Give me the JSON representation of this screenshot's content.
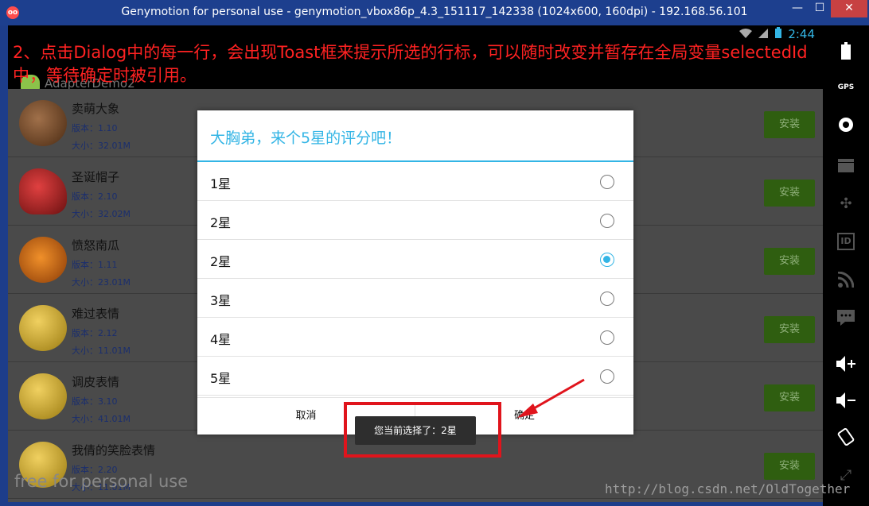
{
  "window": {
    "title": "Genymotion for personal use - genymotion_vbox86p_4.3_151117_142338 (1024x600, 160dpi) - 192.168.56.101",
    "app_icon": "genymotion-icon",
    "minimize": "—",
    "maximize": "☐",
    "close": "✕"
  },
  "status_bar": {
    "time": "2:44",
    "icons": [
      "wifi-icon",
      "signal-icon",
      "battery-icon"
    ]
  },
  "action_bar": {
    "title": "AdapterDemo2"
  },
  "annotation": {
    "text": "2、点击Dialog中的每一行，会出现Toast框来提示所选的行标，可以随时改变并暂存在全局变量selectedId中，等待确定时被引用。",
    "color": "#ff2222"
  },
  "apps": [
    {
      "name": "卖萌大象",
      "version": "版本：1.10",
      "size": "大小：32.01M",
      "install": "安装",
      "icon": "elephant-icon"
    },
    {
      "name": "圣诞帽子",
      "version": "版本：2.10",
      "size": "大小：32.02M",
      "install": "安装",
      "icon": "santa-hat-icon"
    },
    {
      "name": "愤怒南瓜",
      "version": "版本：1.11",
      "size": "大小：23.01M",
      "install": "安装",
      "icon": "pumpkin-icon"
    },
    {
      "name": "难过表情",
      "version": "版本：2.12",
      "size": "大小：11.01M",
      "install": "安装",
      "icon": "sad-face-icon"
    },
    {
      "name": "调皮表情",
      "version": "版本：3.10",
      "size": "大小：41.01M",
      "install": "安装",
      "icon": "tongue-face-icon"
    },
    {
      "name": "我倩的笑脸表情",
      "version": "版本：2.20",
      "size": "大小：11.01M",
      "install": "安装",
      "icon": "smile-face-icon"
    }
  ],
  "dialog": {
    "title": "大胸弟，来个5星的评分吧！",
    "options": [
      {
        "label": "1星",
        "checked": false
      },
      {
        "label": "2星",
        "checked": false
      },
      {
        "label": "2星",
        "checked": true
      },
      {
        "label": "3星",
        "checked": false
      },
      {
        "label": "4星",
        "checked": false
      },
      {
        "label": "5星",
        "checked": false
      }
    ],
    "cancel": "取消",
    "ok": "确定",
    "accent": "#33b5e5"
  },
  "toast": {
    "text": "您当前选择了：2星"
  },
  "watermarks": {
    "personal": "free for personal use",
    "blog": "http://blog.csdn.net/OldTogether"
  },
  "sidebar": {
    "buttons": [
      "battery-icon",
      "gps-icon",
      "webcam-icon",
      "clapperboard-icon",
      "dpad-icon",
      "id-icon",
      "rss-icon",
      "sms-icon",
      "volume-up-icon",
      "volume-down-icon",
      "rotate-icon",
      "pixel-ratio-icon"
    ],
    "gps_label": "GPS",
    "id_label": "ID"
  }
}
